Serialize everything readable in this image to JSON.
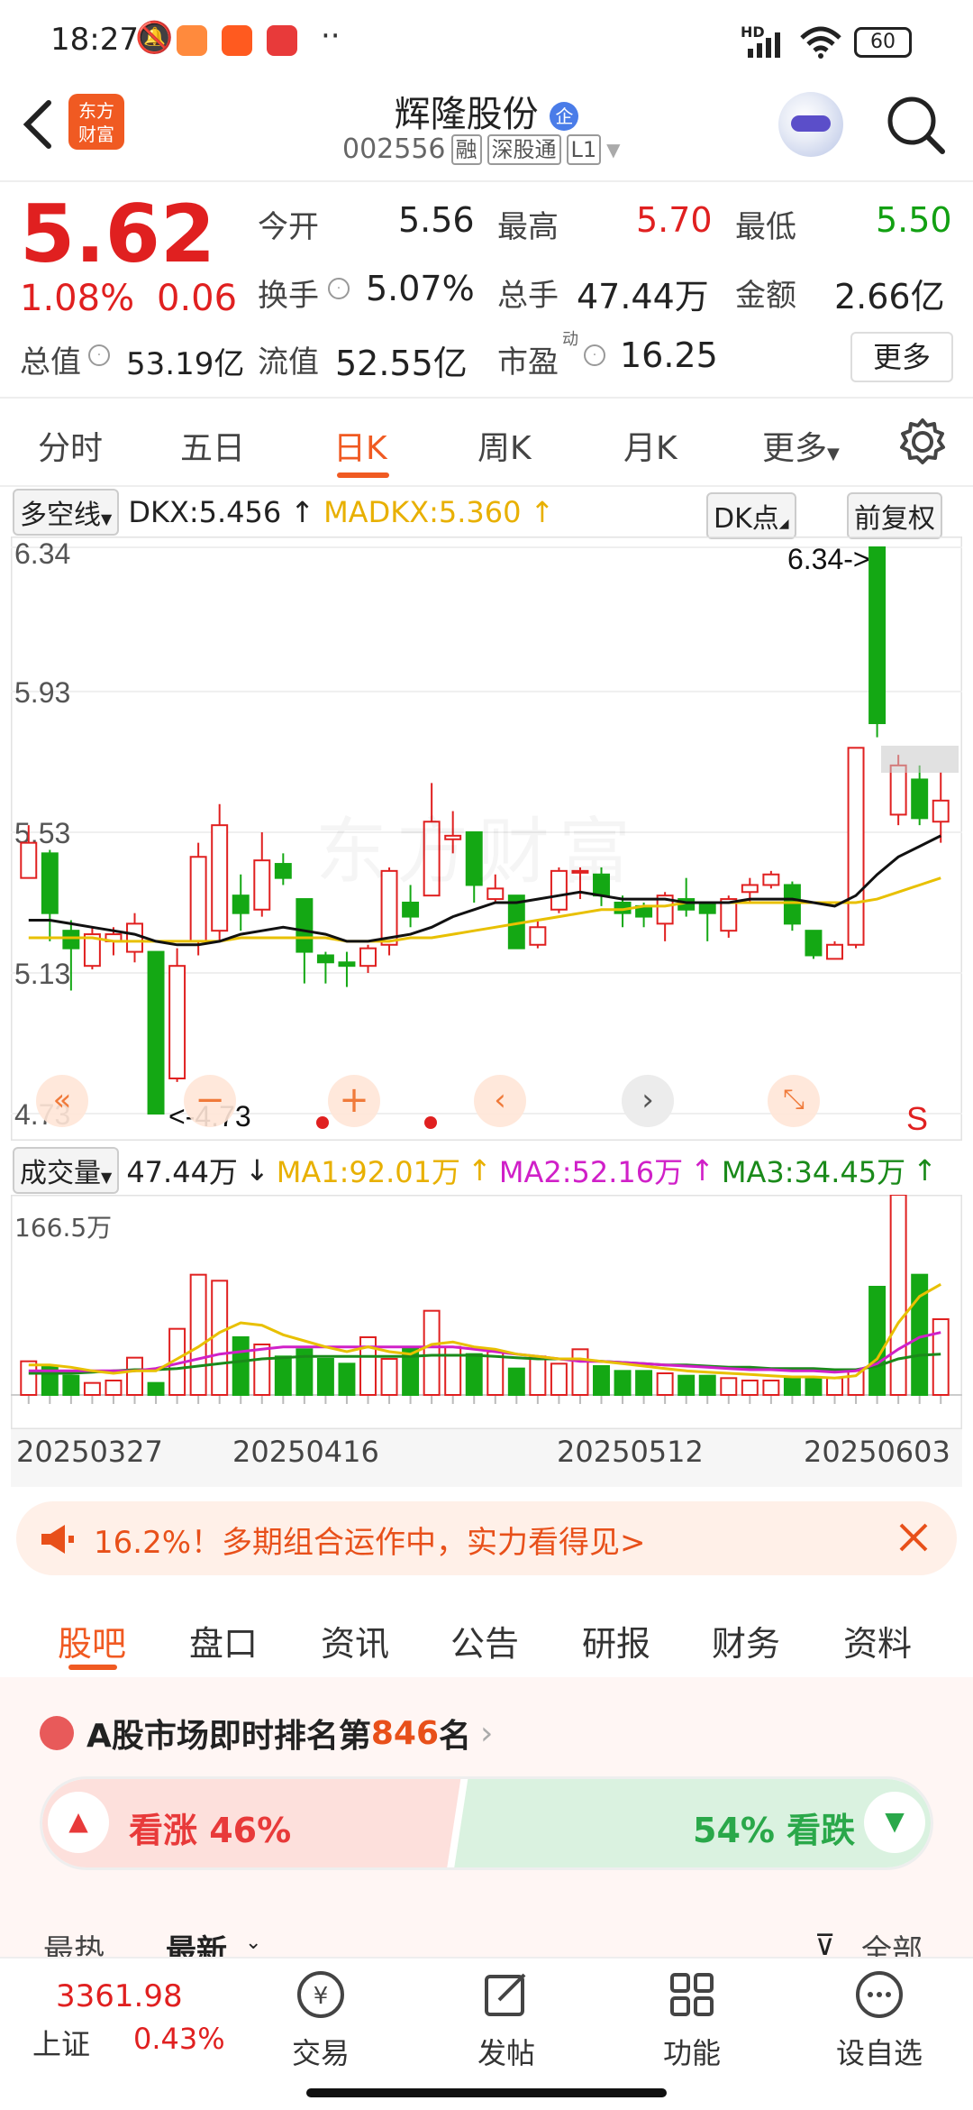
{
  "status_bar": {
    "time": "18:27",
    "battery": "60",
    "network": "HD"
  },
  "header": {
    "title": "辉隆股份",
    "title_badge": "企",
    "code": "002556",
    "tags": [
      "融",
      "深股通",
      "L1"
    ],
    "logo_text": "东方财富"
  },
  "quote": {
    "price": "5.62",
    "change_pct": "1.08%",
    "change": "0.06",
    "open_label": "今开",
    "open": "5.56",
    "high_label": "最高",
    "high": "5.70",
    "low_label": "最低",
    "low": "5.50",
    "turnover_label": "换手",
    "turnover": "5.07%",
    "volume_label": "总手",
    "volume": "47.44万",
    "amount_label": "金额",
    "amount": "2.66亿",
    "mktcap_label": "总值",
    "mktcap": "53.19亿",
    "float_label": "流值",
    "float": "52.55亿",
    "pe_label": "市盈",
    "pe_sup": "动",
    "pe": "16.25",
    "more_button": "更多"
  },
  "period_tabs": [
    "分时",
    "五日",
    "日K",
    "周K",
    "月K",
    "更多"
  ],
  "active_period": "日K",
  "indicator": {
    "name": "多空线",
    "dkx": "DKX:5.456",
    "madkx": "MADKX:5.360",
    "dk_points": "DK点",
    "adjust": "前复权"
  },
  "kchart": {
    "y_labels": [
      "6.34",
      "5.93",
      "5.53",
      "5.13",
      "4.73"
    ],
    "max_marker": "6.34->",
    "min_marker": "<-4.73",
    "signal_label": "S"
  },
  "volume": {
    "name": "成交量",
    "value": "47.44万",
    "ma1": "MA1:92.01万",
    "ma2": "MA2:52.16万",
    "ma3": "MA3:34.45万",
    "max_label": "166.5万",
    "dates": [
      "20250327",
      "20250416",
      "20250512",
      "20250603"
    ]
  },
  "chart_data": {
    "type": "candlestick",
    "ylim": [
      4.73,
      6.34
    ],
    "candles": [
      {
        "o": 5.4,
        "c": 5.5,
        "h": 5.55,
        "l": 5.4,
        "up": true
      },
      {
        "o": 5.47,
        "c": 5.3,
        "h": 5.48,
        "l": 5.22,
        "up": false
      },
      {
        "o": 5.25,
        "c": 5.2,
        "h": 5.28,
        "l": 5.08,
        "up": false
      },
      {
        "o": 5.15,
        "c": 5.24,
        "h": 5.26,
        "l": 5.14,
        "up": true
      },
      {
        "o": 5.22,
        "c": 5.24,
        "h": 5.26,
        "l": 5.18,
        "up": true
      },
      {
        "o": 5.19,
        "c": 5.27,
        "h": 5.3,
        "l": 5.16,
        "up": true
      },
      {
        "o": 5.19,
        "c": 4.73,
        "h": 5.19,
        "l": 4.73,
        "up": false
      },
      {
        "o": 4.83,
        "c": 5.15,
        "h": 5.2,
        "l": 4.82,
        "up": true
      },
      {
        "o": 5.22,
        "c": 5.46,
        "h": 5.5,
        "l": 5.18,
        "up": true
      },
      {
        "o": 5.25,
        "c": 5.55,
        "h": 5.61,
        "l": 5.22,
        "up": true
      },
      {
        "o": 5.35,
        "c": 5.3,
        "h": 5.41,
        "l": 5.25,
        "up": false
      },
      {
        "o": 5.31,
        "c": 5.45,
        "h": 5.53,
        "l": 5.29,
        "up": true
      },
      {
        "o": 5.44,
        "c": 5.4,
        "h": 5.47,
        "l": 5.38,
        "up": false
      },
      {
        "o": 5.34,
        "c": 5.19,
        "h": 5.34,
        "l": 5.1,
        "up": false
      },
      {
        "o": 5.18,
        "c": 5.16,
        "h": 5.19,
        "l": 5.1,
        "up": false
      },
      {
        "o": 5.16,
        "c": 5.15,
        "h": 5.19,
        "l": 5.09,
        "up": false
      },
      {
        "o": 5.15,
        "c": 5.2,
        "h": 5.21,
        "l": 5.13,
        "up": true
      },
      {
        "o": 5.21,
        "c": 5.42,
        "h": 5.43,
        "l": 5.18,
        "up": true
      },
      {
        "o": 5.33,
        "c": 5.29,
        "h": 5.38,
        "l": 5.26,
        "up": false
      },
      {
        "o": 5.35,
        "c": 5.56,
        "h": 5.67,
        "l": 5.35,
        "up": true
      },
      {
        "o": 5.51,
        "c": 5.52,
        "h": 5.59,
        "l": 5.47,
        "up": true
      },
      {
        "o": 5.53,
        "c": 5.38,
        "h": 5.53,
        "l": 5.33,
        "up": false
      },
      {
        "o": 5.34,
        "c": 5.37,
        "h": 5.41,
        "l": 5.33,
        "up": true
      },
      {
        "o": 5.35,
        "c": 5.2,
        "h": 5.35,
        "l": 5.2,
        "up": false
      },
      {
        "o": 5.21,
        "c": 5.26,
        "h": 5.28,
        "l": 5.2,
        "up": true
      },
      {
        "o": 5.31,
        "c": 5.42,
        "h": 5.43,
        "l": 5.3,
        "up": true
      },
      {
        "o": 5.42,
        "c": 5.42,
        "h": 5.43,
        "l": 5.34,
        "up": true
      },
      {
        "o": 5.41,
        "c": 5.35,
        "h": 5.43,
        "l": 5.32,
        "up": false
      },
      {
        "o": 5.33,
        "c": 5.3,
        "h": 5.35,
        "l": 5.26,
        "up": false
      },
      {
        "o": 5.32,
        "c": 5.29,
        "h": 5.33,
        "l": 5.26,
        "up": false
      },
      {
        "o": 5.27,
        "c": 5.35,
        "h": 5.36,
        "l": 5.22,
        "up": true
      },
      {
        "o": 5.34,
        "c": 5.31,
        "h": 5.4,
        "l": 5.29,
        "up": false
      },
      {
        "o": 5.33,
        "c": 5.3,
        "h": 5.33,
        "l": 5.22,
        "up": false
      },
      {
        "o": 5.25,
        "c": 5.34,
        "h": 5.35,
        "l": 5.23,
        "up": true
      },
      {
        "o": 5.36,
        "c": 5.38,
        "h": 5.4,
        "l": 5.33,
        "up": true
      },
      {
        "o": 5.38,
        "c": 5.41,
        "h": 5.42,
        "l": 5.37,
        "up": true
      },
      {
        "o": 5.38,
        "c": 5.27,
        "h": 5.39,
        "l": 5.25,
        "up": false
      },
      {
        "o": 5.25,
        "c": 5.18,
        "h": 5.25,
        "l": 5.17,
        "up": false
      },
      {
        "o": 5.17,
        "c": 5.21,
        "h": 5.22,
        "l": 5.17,
        "up": true
      },
      {
        "o": 5.21,
        "c": 5.77,
        "h": 5.77,
        "l": 5.2,
        "up": true
      },
      {
        "o": 6.34,
        "c": 5.84,
        "h": 6.34,
        "l": 5.8,
        "up": false
      },
      {
        "o": 5.58,
        "c": 5.72,
        "h": 5.75,
        "l": 5.55,
        "up": true
      },
      {
        "o": 5.68,
        "c": 5.57,
        "h": 5.72,
        "l": 5.55,
        "up": false
      },
      {
        "o": 5.56,
        "c": 5.62,
        "h": 5.7,
        "l": 5.5,
        "up": true
      }
    ],
    "dkx": [
      5.28,
      5.28,
      5.27,
      5.26,
      5.25,
      5.24,
      5.22,
      5.21,
      5.21,
      5.22,
      5.24,
      5.25,
      5.26,
      5.25,
      5.24,
      5.22,
      5.22,
      5.23,
      5.24,
      5.26,
      5.29,
      5.31,
      5.33,
      5.33,
      5.34,
      5.35,
      5.36,
      5.35,
      5.34,
      5.34,
      5.34,
      5.33,
      5.33,
      5.33,
      5.34,
      5.34,
      5.34,
      5.33,
      5.32,
      5.35,
      5.41,
      5.46,
      5.49,
      5.52
    ],
    "madkx": [
      5.23,
      5.23,
      5.23,
      5.23,
      5.22,
      5.22,
      5.22,
      5.22,
      5.22,
      5.22,
      5.23,
      5.23,
      5.23,
      5.23,
      5.23,
      5.22,
      5.22,
      5.22,
      5.23,
      5.23,
      5.24,
      5.25,
      5.26,
      5.27,
      5.28,
      5.29,
      5.3,
      5.31,
      5.31,
      5.32,
      5.32,
      5.33,
      5.33,
      5.33,
      5.33,
      5.33,
      5.33,
      5.33,
      5.33,
      5.33,
      5.34,
      5.36,
      5.38,
      5.4
    ],
    "volume_values": [
      28,
      24,
      16,
      10,
      12,
      31,
      10,
      55,
      100,
      95,
      48,
      42,
      32,
      38,
      30,
      26,
      48,
      30,
      40,
      70,
      40,
      34,
      36,
      22,
      32,
      26,
      38,
      24,
      20,
      20,
      18,
      16,
      16,
      14,
      12,
      12,
      14,
      14,
      14,
      20,
      90,
      166.5,
      100,
      63
    ],
    "vol_ma1": [
      25,
      25,
      23,
      20,
      18,
      20,
      20,
      30,
      40,
      52,
      60,
      58,
      50,
      45,
      40,
      36,
      40,
      36,
      34,
      42,
      44,
      40,
      38,
      34,
      32,
      30,
      30,
      28,
      26,
      24,
      22,
      20,
      19,
      18,
      17,
      16,
      15,
      15,
      14,
      16,
      30,
      60,
      82,
      92
    ],
    "vol_ma2": [
      20,
      20,
      20,
      20,
      20,
      20,
      22,
      26,
      30,
      34,
      36,
      38,
      40,
      40,
      40,
      40,
      40,
      40,
      40,
      40,
      40,
      38,
      36,
      34,
      32,
      30,
      28,
      28,
      27,
      26,
      25,
      24,
      23,
      22,
      21,
      21,
      20,
      20,
      19,
      20,
      26,
      38,
      48,
      52
    ],
    "vol_ma3": [
      18,
      18,
      18,
      19,
      20,
      21,
      21,
      22,
      24,
      26,
      28,
      30,
      31,
      32,
      32,
      32,
      32,
      32,
      32,
      33,
      33,
      33,
      32,
      31,
      30,
      30,
      29,
      28,
      27,
      26,
      25,
      25,
      24,
      23,
      23,
      22,
      22,
      22,
      21,
      21,
      24,
      30,
      33,
      34
    ]
  },
  "promo": {
    "text": "16.2%！多期组合运作中，实力看得见>"
  },
  "content_tabs": [
    "股吧",
    "盘口",
    "资讯",
    "公告",
    "研报",
    "财务",
    "资料"
  ],
  "active_content_tab": "股吧",
  "ranking": {
    "prefix": "A股市场即时排名第",
    "rank": "846",
    "suffix": "名",
    "bull_label": "看涨 46%",
    "bear_label": "54% 看跌",
    "bull_pct": 46,
    "sort_hot": "最热",
    "sort_new": "最新",
    "filter_all": "全部"
  },
  "bottom_nav": {
    "index_value": "3361.98",
    "index_name": "上证",
    "index_change": "0.43%",
    "items": [
      "交易",
      "发帖",
      "功能",
      "设自选"
    ]
  }
}
